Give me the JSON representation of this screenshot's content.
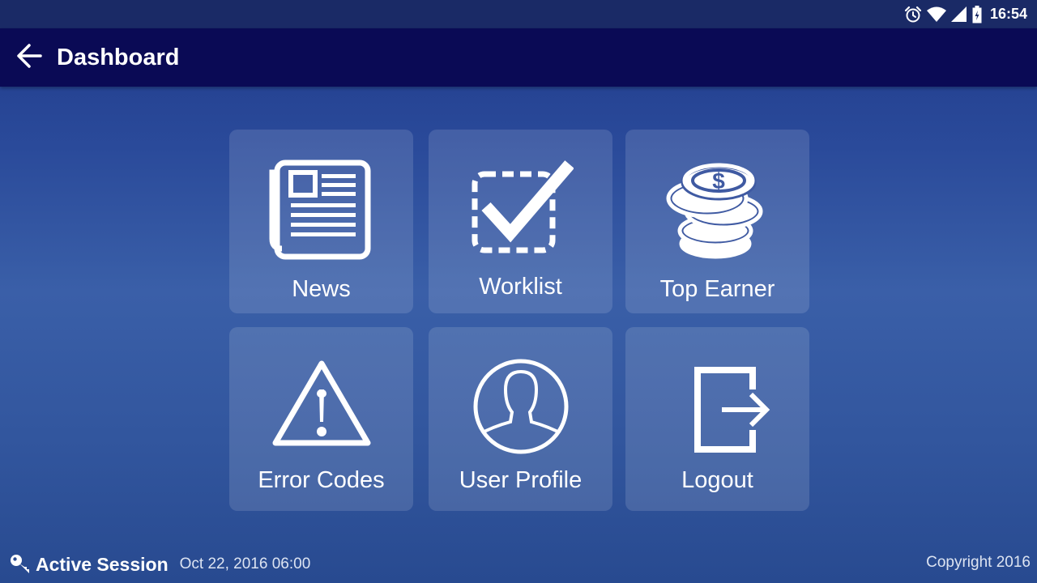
{
  "status_bar": {
    "time": "16:54",
    "icons": [
      "alarm-icon",
      "wifi-icon",
      "signal-icon",
      "battery-charging-icon"
    ]
  },
  "app_bar": {
    "title": "Dashboard",
    "back_icon": "arrow-left-icon"
  },
  "tiles": [
    {
      "label": "News",
      "icon": "newspaper-icon"
    },
    {
      "label": "Worklist",
      "icon": "checkbox-check-icon"
    },
    {
      "label": "Top Earner",
      "icon": "coin-stack-icon"
    },
    {
      "label": "Error Codes",
      "icon": "warning-triangle-icon"
    },
    {
      "label": "User Profile",
      "icon": "user-circle-icon"
    },
    {
      "label": "Logout",
      "icon": "logout-icon"
    }
  ],
  "footer": {
    "session_label": "Active Session",
    "session_date": "Oct 22, 2016 06:00",
    "copyright": "Copyright 2016",
    "key_icon": "key-icon"
  },
  "colors": {
    "app_bar": "#0a0a55",
    "status_bar": "#1a2a66",
    "background_top": "#203a8a",
    "background_mid": "#3a5fa8"
  }
}
